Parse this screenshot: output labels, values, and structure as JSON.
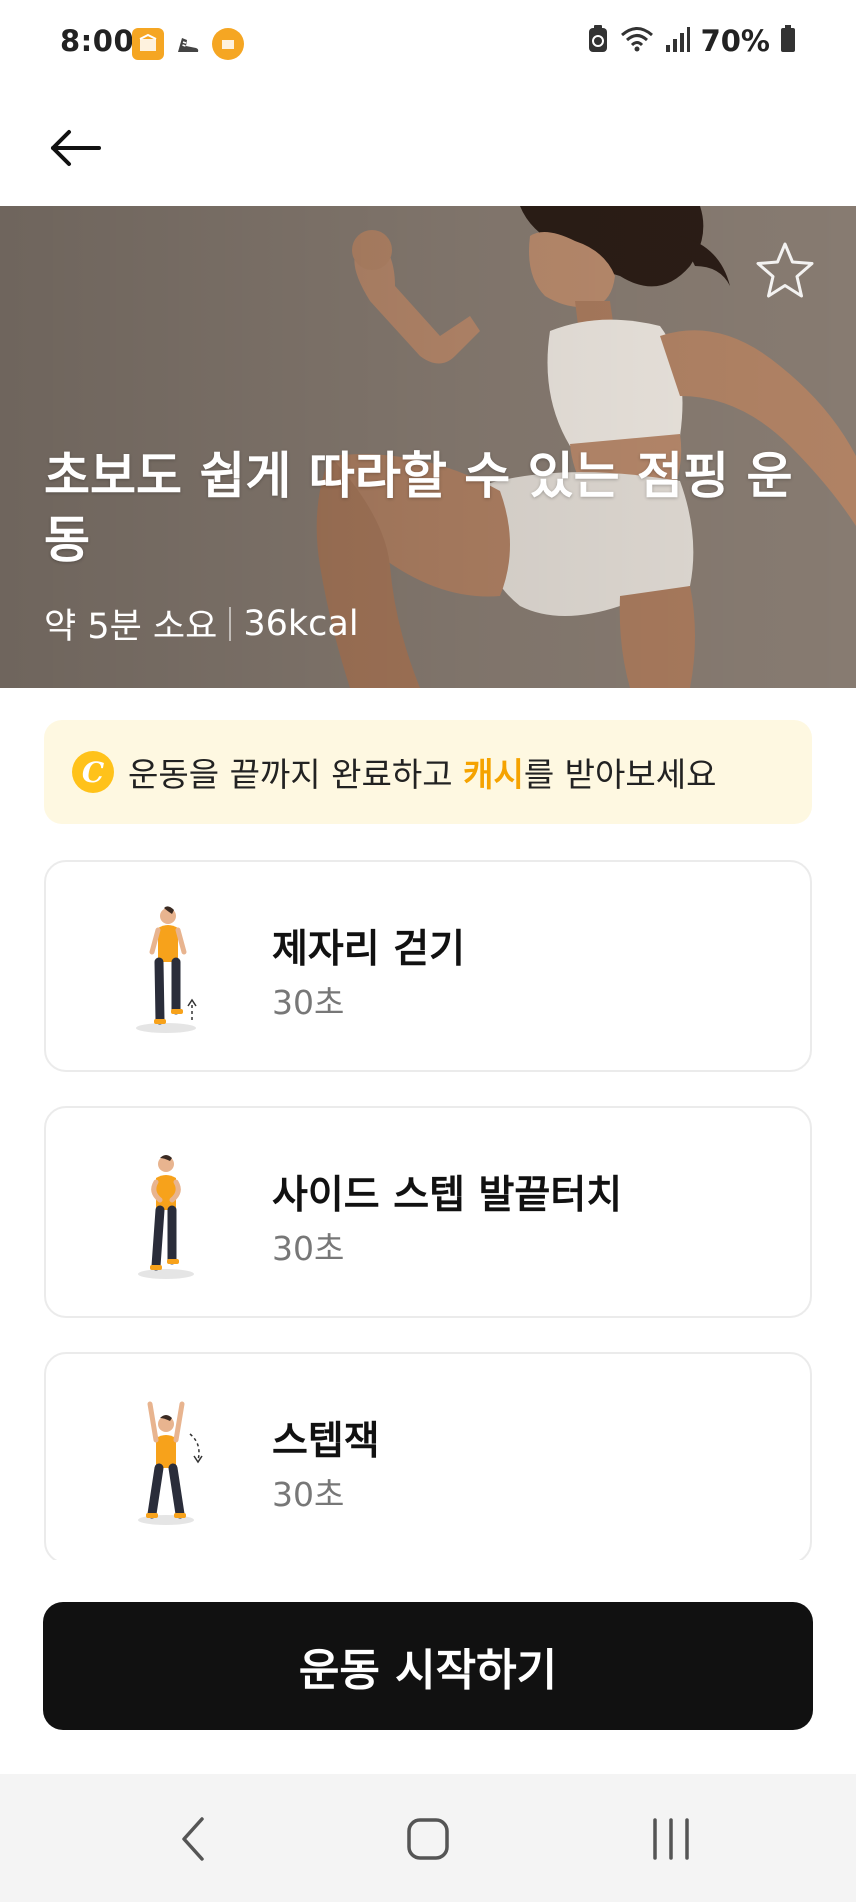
{
  "status_bar": {
    "time": "8:00",
    "notification_icons": [
      "box-icon",
      "shoe-icon",
      "box-round-icon"
    ],
    "status_icons": [
      "recycle-icon",
      "wifi-icon",
      "signal-icon",
      "battery-icon"
    ],
    "battery": "70%"
  },
  "top_bar": {
    "back_icon": "arrow-left-icon"
  },
  "hero": {
    "title": "초보도 쉽게 따라할 수 있는 점핑 운동",
    "duration": "약 5분 소요",
    "calories": "36kcal",
    "favorite_icon": "star-outline-icon"
  },
  "cash_banner": {
    "icon": "coin-icon",
    "icon_letter": "C",
    "text_before": "운동을 끝까지 완료하고 ",
    "highlight": "캐시",
    "text_after": "를 받아보세요",
    "highlight_color": "#f5a300",
    "background_color": "#fef8e1"
  },
  "exercises": [
    {
      "name": "제자리 걷기",
      "duration": "30초"
    },
    {
      "name": "사이드 스텝 발끝터치",
      "duration": "30초"
    },
    {
      "name": "스텝잭",
      "duration": "30초"
    }
  ],
  "start_button": {
    "label": "운동 시작하기"
  },
  "nav_bar": {
    "buttons": [
      "back-nav-icon",
      "home-nav-icon",
      "recents-nav-icon"
    ]
  },
  "colors": {
    "accent_orange": "#f5a300",
    "figure_orange": "#f7a21b",
    "button_black": "#111111"
  }
}
